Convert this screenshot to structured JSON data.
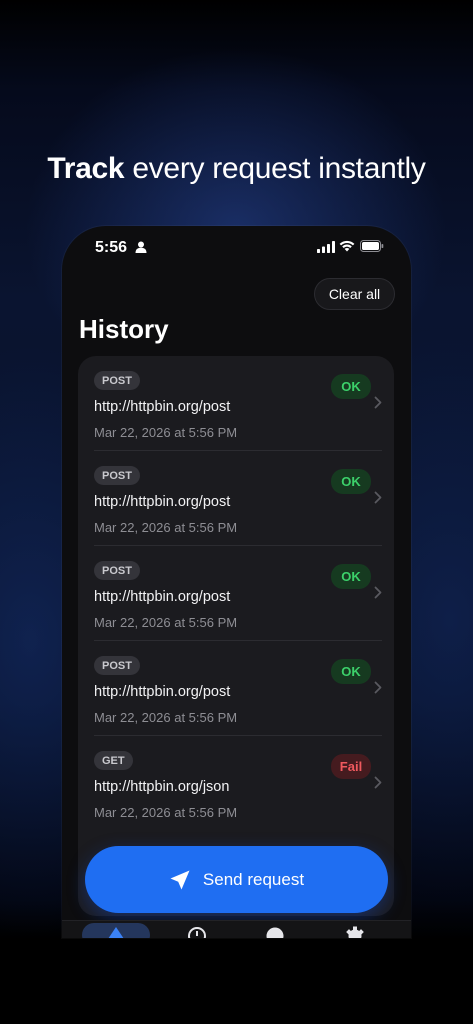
{
  "headline": {
    "strong": "Track",
    "rest": "every request instantly"
  },
  "status_bar": {
    "time": "5:56"
  },
  "header": {
    "clear_all_label": "Clear all",
    "title": "History"
  },
  "history": [
    {
      "method": "POST",
      "url": "http://httpbin.org/post",
      "date": "Mar 22, 2026 at 5:56 PM",
      "status": "OK"
    },
    {
      "method": "POST",
      "url": "http://httpbin.org/post",
      "date": "Mar 22, 2026 at 5:56 PM",
      "status": "OK"
    },
    {
      "method": "POST",
      "url": "http://httpbin.org/post",
      "date": "Mar 22, 2026 at 5:56 PM",
      "status": "OK"
    },
    {
      "method": "POST",
      "url": "http://httpbin.org/post",
      "date": "Mar 22, 2026 at 5:56 PM",
      "status": "OK"
    },
    {
      "method": "GET",
      "url": "http://httpbin.org/json",
      "date": "Mar 22, 2026 at 5:56 PM",
      "status": "Fail"
    }
  ],
  "send_button": {
    "label": "Send request",
    "icon": "paper-plane-icon"
  },
  "tab_bar": {
    "icons": [
      "requests-icon",
      "history-clock-icon",
      "help-icon",
      "settings-gear-icon"
    ]
  },
  "colors": {
    "accent": "#1f6ef2",
    "ok": "#3cd06a",
    "fail": "#f0595e",
    "card": "#1b1b1f"
  }
}
